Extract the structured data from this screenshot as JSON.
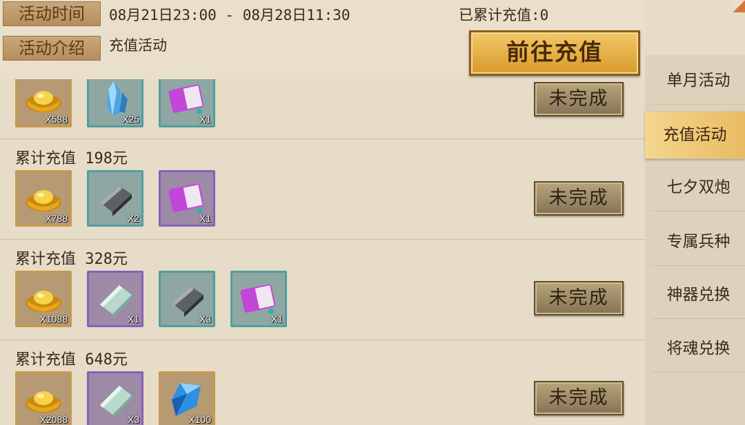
{
  "header": {
    "time_label": "活动时间",
    "time_range": "08月21日23:00 - 08月28日11:30",
    "recharged": "已累计充值:0",
    "desc_label": "活动介绍",
    "desc_text": "充值活动",
    "goto_button": "前往充值"
  },
  "rows": [
    {
      "title": "",
      "status": "未完成",
      "items": [
        {
          "icon": "gold-ingot-icon",
          "count": "X588"
        },
        {
          "icon": "blue-crystal-icon",
          "count": "X25"
        },
        {
          "icon": "purple-scroll-icon",
          "count": "X1"
        }
      ]
    },
    {
      "title": "累计充值 198元",
      "status": "未完成",
      "items": [
        {
          "icon": "gold-ingot-icon",
          "count": "X788"
        },
        {
          "icon": "iron-ingot-icon",
          "count": "X2"
        },
        {
          "icon": "purple-scroll-icon",
          "count": "X1"
        }
      ]
    },
    {
      "title": "累计充值 328元",
      "status": "未完成",
      "items": [
        {
          "icon": "gold-ingot-icon",
          "count": "X1088"
        },
        {
          "icon": "jade-ingot-icon",
          "count": "X1"
        },
        {
          "icon": "iron-ingot-icon",
          "count": "X3"
        },
        {
          "icon": "purple-scroll-icon",
          "count": "X1"
        }
      ]
    },
    {
      "title": "累计充值 648元",
      "status": "未完成",
      "items": [
        {
          "icon": "gold-ingot-icon",
          "count": "X2088"
        },
        {
          "icon": "jade-ingot-icon",
          "count": "X3"
        },
        {
          "icon": "blue-gem-icon",
          "count": "X100"
        }
      ]
    }
  ],
  "sidebar": {
    "items": [
      {
        "label": "单月活动"
      },
      {
        "label": "充值活动",
        "active": true
      },
      {
        "label": "七夕双炮"
      },
      {
        "label": "专属兵种"
      },
      {
        "label": "神器兑换"
      },
      {
        "label": "将魂兑换"
      }
    ]
  }
}
